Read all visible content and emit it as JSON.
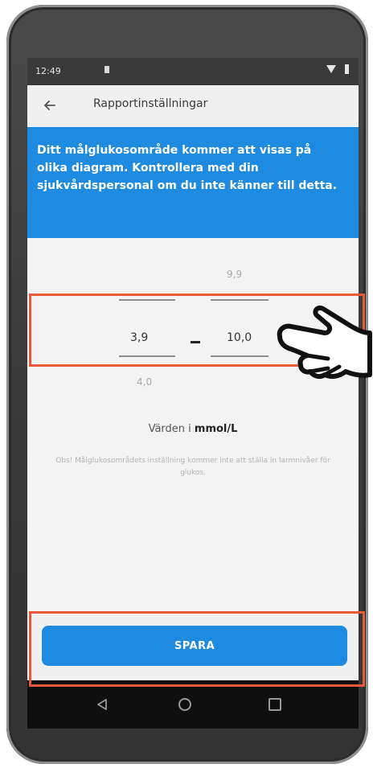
{
  "status_bar": {
    "time": "12:49"
  },
  "app_bar": {
    "title": "Rapportinställningar"
  },
  "info_banner": {
    "text": "Ditt målglukosområde kommer att visas på olika diagram. Kontrollera med din sjukvårdspersonal om du inte känner till detta."
  },
  "range_picker": {
    "high_above": "9,9",
    "low_value": "3,9",
    "high_value": "10,0",
    "low_below": "4,0"
  },
  "units": {
    "prefix": "Värden i",
    "unit": "mmol/L"
  },
  "note": "Obs! Målglukosområdets inställning kommer inte att ställa in larmnivåer för glukos.",
  "save_button": {
    "label": "SPARA"
  },
  "icons": {
    "back": "arrow-left-icon",
    "pointer": "pointing-hand-icon",
    "nav_back": "triangle-back-icon",
    "nav_home": "circle-home-icon",
    "nav_recent": "square-recent-icon"
  },
  "colors": {
    "accent": "#1f8be0",
    "highlight": "#e85a3a"
  }
}
